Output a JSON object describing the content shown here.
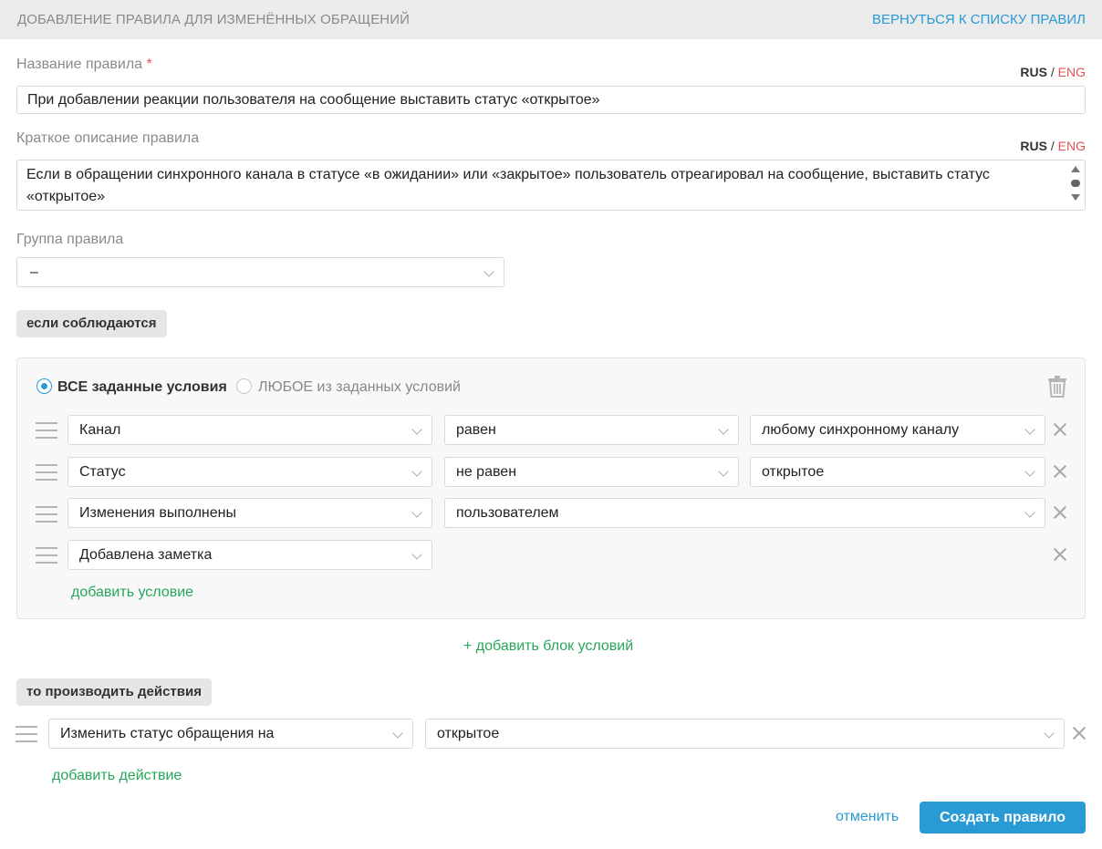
{
  "header": {
    "title": "ДОБАВЛЕНИЕ ПРАВИЛА ДЛЯ ИЗМЕНЁННЫХ ОБРАЩЕНИЙ",
    "back_link": "ВЕРНУТЬСЯ К СПИСКУ ПРАВИЛ"
  },
  "lang": {
    "rus": "RUS",
    "sep": "/",
    "eng": "ENG"
  },
  "rule_name": {
    "label": "Название правила",
    "required_mark": "*",
    "value": "При добавлении реакции пользователя на сообщение  выставить статус «открытое»"
  },
  "rule_description": {
    "label": "Краткое описание правила",
    "value": "Если в обращении синхронного канала в статусе «в ожидании» или «закрытое» пользователь отреагировал на сообщение, выставить статус «открытое»"
  },
  "rule_group": {
    "label": "Группа правила",
    "value": "–"
  },
  "conditions": {
    "section_label": "если соблюдаются",
    "mode_all": "ВСЕ заданные условия",
    "mode_any": "ЛЮБОЕ из заданных условий",
    "mode_selected": "all",
    "rows": [
      {
        "field": "Канал",
        "operator": "равен",
        "value": "любому синхронному каналу"
      },
      {
        "field": "Статус",
        "operator": "не равен",
        "value": "открытое"
      },
      {
        "field": "Изменения выполнены",
        "operator": "пользователем"
      },
      {
        "field": "Добавлена заметка"
      }
    ],
    "add_condition": "добавить условие",
    "add_block": "+ добавить блок условий"
  },
  "actions": {
    "section_label": "то производить действия",
    "rows": [
      {
        "action": "Изменить статус обращения на",
        "value": "открытое"
      }
    ],
    "add_action": "добавить действие"
  },
  "footer": {
    "cancel": "отменить",
    "submit": "Создать правило"
  },
  "colors": {
    "accent": "#2a9ad4",
    "link_green": "#27a65a",
    "required_red": "#e05454"
  },
  "icons": [
    "trash-icon",
    "drag-handle-icon",
    "close-icon",
    "chevron-down-icon"
  ]
}
